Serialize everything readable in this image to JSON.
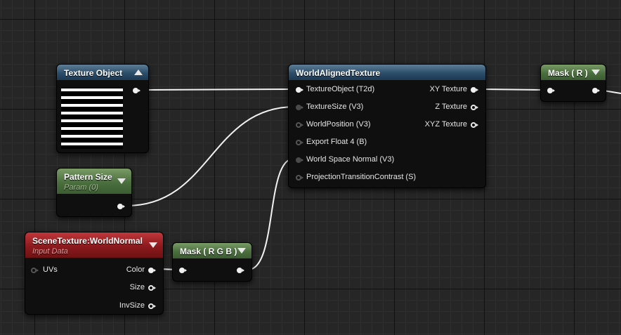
{
  "nodes": {
    "texture_object": {
      "title": "Texture Object"
    },
    "pattern_size": {
      "title": "Pattern Size",
      "subtitle": "Param (0)"
    },
    "scene_texture": {
      "title": "SceneTexture:WorldNormal",
      "subtitle": "Input Data",
      "inputs": [
        "UVs"
      ],
      "outputs": [
        "Color",
        "Size",
        "InvSize"
      ]
    },
    "mask_rgb": {
      "title": "Mask ( R G B )"
    },
    "world_aligned": {
      "title": "WorldAlignedTexture",
      "inputs": [
        "TextureObject (T2d)",
        "TextureSize (V3)",
        "WorldPosition (V3)",
        "Export Float 4 (B)",
        "World Space Normal (V3)",
        "ProjectionTransitionContrast (S)"
      ],
      "outputs": [
        "XY Texture",
        "Z Texture",
        "XYZ Texture"
      ]
    },
    "mask_r": {
      "title": "Mask ( R )"
    }
  },
  "colors": {
    "canvas": "#262626",
    "header_blue": "#2c4d69",
    "header_green": "#4b6f3f",
    "header_red": "#8c1a1d",
    "wire": "#f2f2f2"
  },
  "icons": {
    "collapse": "triangle-up",
    "expand": "triangle-down",
    "pin": "circle-arrow"
  }
}
